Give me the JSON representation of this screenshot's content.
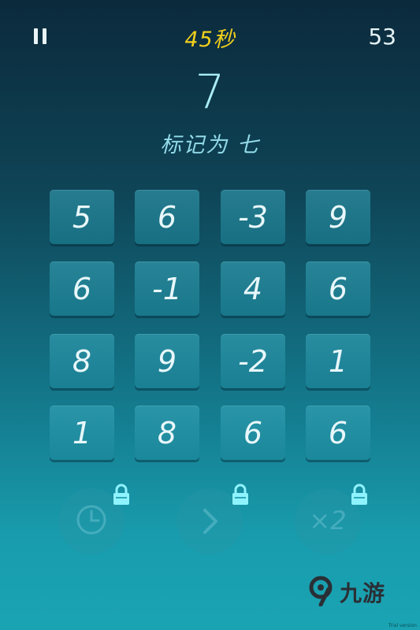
{
  "header": {
    "timer": "45秒",
    "score": "53"
  },
  "target": {
    "number": "7",
    "instruction": "标记为 七"
  },
  "grid": {
    "rows": [
      [
        "5",
        "6",
        "-3",
        "9"
      ],
      [
        "6",
        "-1",
        "4",
        "6"
      ],
      [
        "8",
        "9",
        "-2",
        "1"
      ],
      [
        "1",
        "8",
        "6",
        "6"
      ]
    ]
  },
  "powerups": [
    {
      "name": "clock-icon",
      "locked": true
    },
    {
      "name": "skip-icon",
      "locked": true
    },
    {
      "name": "double-icon",
      "label": "×2",
      "locked": true
    }
  ],
  "watermark": {
    "text": "九游",
    "trial": "Trial version"
  },
  "colors": {
    "timer": "#f2cf1d",
    "target": "#a9ecf7",
    "lock": "#7ff0ff"
  }
}
